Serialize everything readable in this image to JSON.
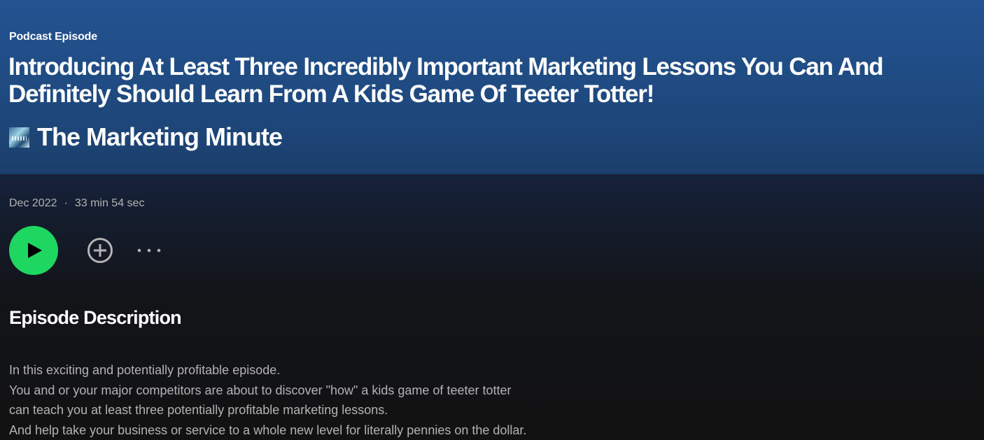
{
  "header": {
    "kind_label": "Podcast Episode",
    "title": "Introducing At Least Three Incredibly Important Marketing Lessons You Can And Definitely Should Learn From A Kids Game Of Teeter Totter!",
    "show_name": "The Marketing Minute",
    "gradient_color": "#245392"
  },
  "meta": {
    "date": "Dec 2022",
    "separator": "·",
    "duration": "33 min 54 sec"
  },
  "controls": {
    "play_icon": "play-icon",
    "add_icon": "plus-circle-icon",
    "more_icon": "more-dots-icon",
    "play_color": "#1ed760"
  },
  "description": {
    "heading": "Episode Description",
    "lines": [
      "In this exciting and potentially profitable episode.",
      "You and or your major competitors are about to discover \"how\" a kids game of teeter totter",
      "can teach you at least three potentially profitable marketing lessons.",
      "And help take your business or service to a whole new level for literally pennies on the dollar."
    ]
  }
}
